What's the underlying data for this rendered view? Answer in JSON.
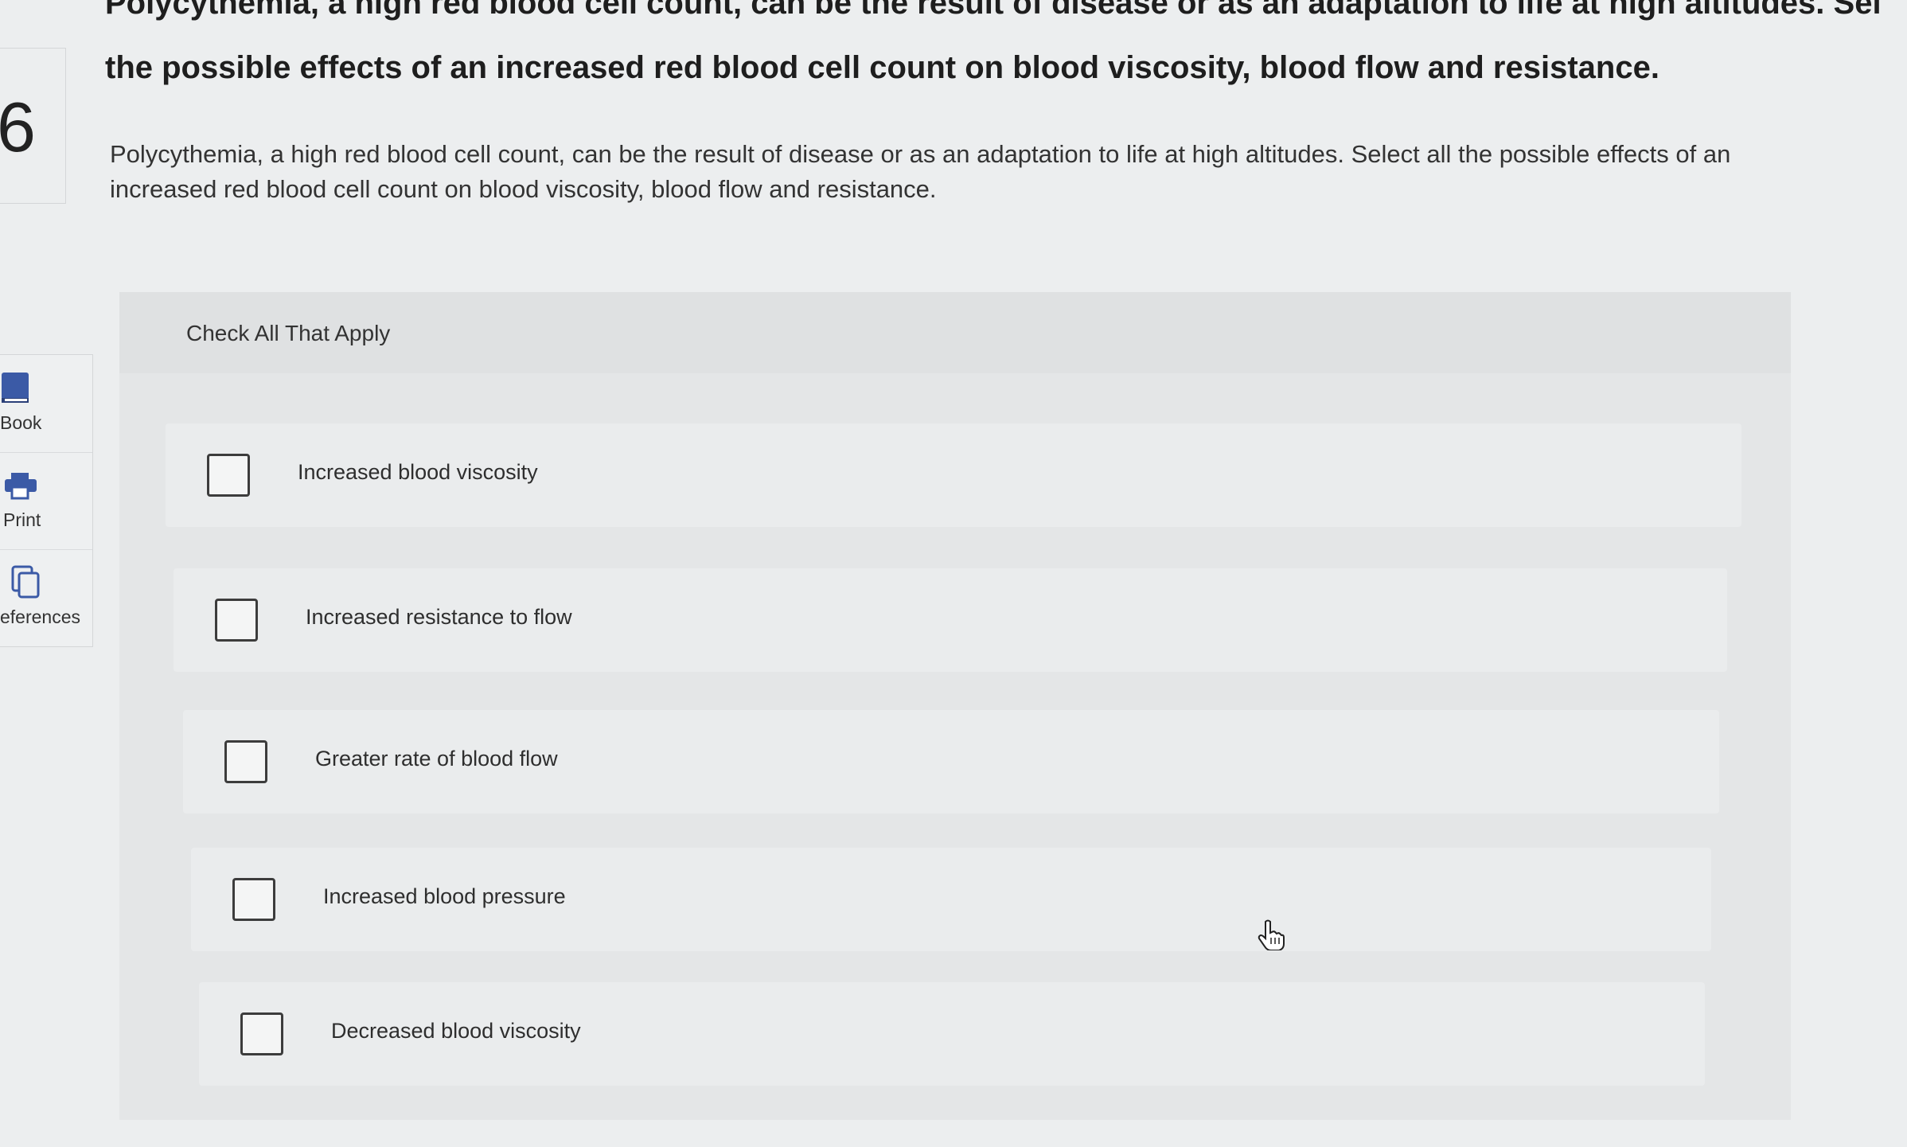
{
  "question": {
    "cut_off_line": "Polycythemia, a high red blood cell count, can be the result of disease or as an adaptation to life at high altitudes. Select all",
    "heading": "the possible effects of an increased red blood cell count on blood viscosity, blood flow and resistance.",
    "number": "6",
    "prompt": "Polycythemia, a high red blood cell count, can be the result of disease or as an adaptation to life at high altitudes. Select all the possible effects of an increased red blood cell count on blood viscosity, blood flow and resistance."
  },
  "sidebar": {
    "tools": [
      {
        "label": "Book",
        "icon": "book-icon"
      },
      {
        "label": "Print",
        "icon": "print-icon"
      },
      {
        "label": "eferences",
        "icon": "references-icon"
      }
    ]
  },
  "panel": {
    "instruction": "Check All That Apply",
    "options": [
      {
        "label": "Increased blood viscosity",
        "checked": false
      },
      {
        "label": "Increased resistance to flow",
        "checked": false
      },
      {
        "label": "Greater rate of blood flow",
        "checked": false
      },
      {
        "label": "Increased blood pressure",
        "checked": false
      },
      {
        "label": "Decreased blood viscosity",
        "checked": false
      }
    ]
  },
  "colors": {
    "accent": "#3b5aa6",
    "background": "#eceeef"
  }
}
